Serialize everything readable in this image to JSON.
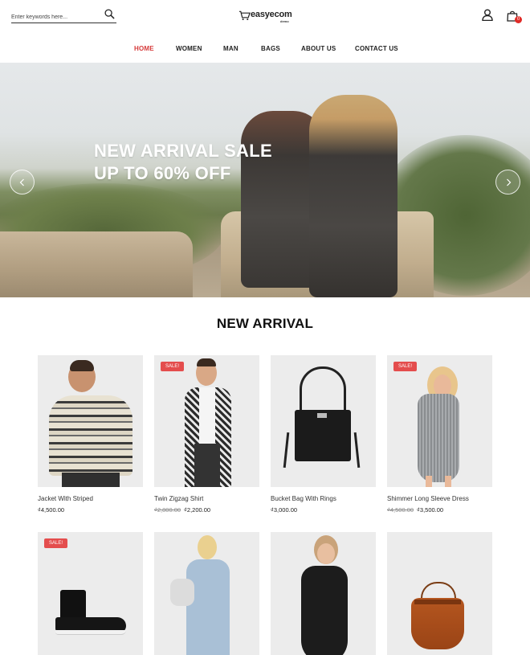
{
  "header": {
    "search_placeholder": "Enter keywords here...",
    "logo_text": "easyecom",
    "logo_sub": "demo",
    "cart_count": "0"
  },
  "nav": {
    "items": [
      "HOME",
      "WOMEN",
      "MAN",
      "BAGS",
      "ABOUT US",
      "CONTACT US"
    ],
    "active": "HOME"
  },
  "hero": {
    "line1": "NEW ARRIVAL SALE",
    "line2": "UP TO 60% OFF"
  },
  "section": {
    "title": "NEW ARRIVAL"
  },
  "products": [
    {
      "name": "Jacket With Striped",
      "price": "₫4,500.00",
      "old_price": "",
      "sale_label": ""
    },
    {
      "name": "Twin Zigzag Shirt",
      "price": "₫2,200.00",
      "old_price": "₫2,800.00",
      "sale_label": "SALE!"
    },
    {
      "name": "Bucket Bag With Rings",
      "price": "₫3,000.00",
      "old_price": "",
      "sale_label": ""
    },
    {
      "name": "Shimmer Long Sleeve Dress",
      "price": "₫3,500.00",
      "old_price": "₫4,500.00",
      "sale_label": "SALE!"
    },
    {
      "name": "",
      "price": "",
      "old_price": "",
      "sale_label": "SALE!"
    },
    {
      "name": "",
      "price": "",
      "old_price": "",
      "sale_label": ""
    },
    {
      "name": "",
      "price": "",
      "old_price": "",
      "sale_label": ""
    },
    {
      "name": "",
      "price": "",
      "old_price": "",
      "sale_label": ""
    }
  ],
  "colors": {
    "accent": "#d63a3a",
    "sale_badge": "#e44d4d",
    "card_bg": "#ececec"
  },
  "icons": [
    "search-icon",
    "cart-logo-icon",
    "user-icon",
    "shopping-bag-icon",
    "chevron-left-icon",
    "chevron-right-icon"
  ]
}
